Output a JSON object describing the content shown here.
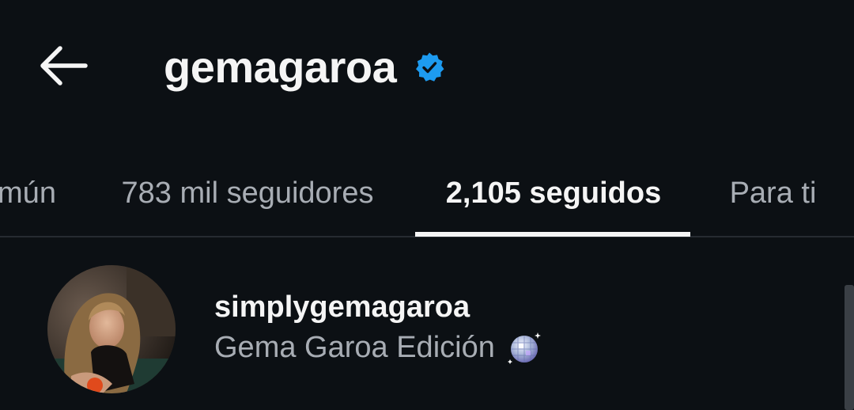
{
  "header": {
    "back_icon": "arrow-left-icon",
    "title": "gemagaroa",
    "verified_icon": "verified-badge-icon",
    "verified_color": "#1d9bf0"
  },
  "tabs": [
    {
      "label": "mún",
      "active": false
    },
    {
      "label": "783 mil seguidores",
      "active": false
    },
    {
      "label": "2,105 seguidos",
      "active": true
    },
    {
      "label": "Para ti",
      "active": false
    }
  ],
  "list": [
    {
      "username": "simplygemagaroa",
      "full_name": "Gema Garoa Edición",
      "emoji_icon": "mirror-ball-icon",
      "avatar_icon": "profile-photo"
    }
  ],
  "colors": {
    "background": "#0c1014",
    "text_primary": "#f5f5f5",
    "text_secondary": "#a8adb4",
    "divider": "#262b31"
  }
}
